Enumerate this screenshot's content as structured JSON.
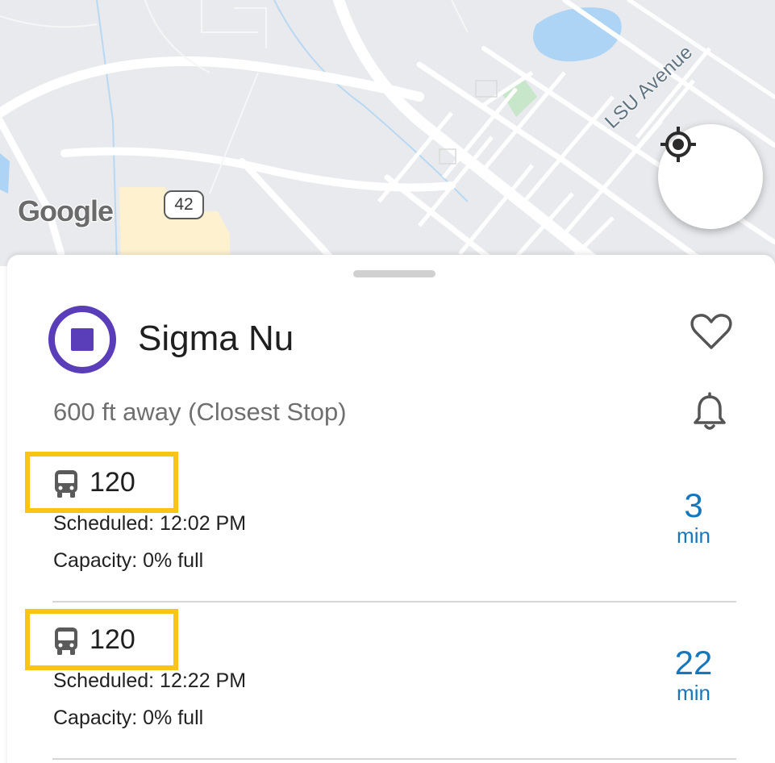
{
  "map": {
    "road_label": "LSU Avenue",
    "route_shield": "42",
    "attribution": "Google",
    "colors": {
      "land": "#e8eaed",
      "road": "#ffffff",
      "water": "#aed4f5",
      "park": "#c8e6c9",
      "sand": "#fdf1cf"
    }
  },
  "stop": {
    "name": "Sigma Nu",
    "distance": "600 ft away (Closest Stop)",
    "icon_color": "#5a3db8",
    "favorite_icon": "heart-outline-icon",
    "notify_icon": "bell-icon"
  },
  "arrivals": [
    {
      "route": "120",
      "scheduled": "Scheduled: 12:02 PM",
      "capacity": "Capacity: 0% full",
      "eta_value": "3",
      "eta_unit": "min"
    },
    {
      "route": "120",
      "scheduled": "Scheduled: 12:22 PM",
      "capacity": "Capacity: 0% full",
      "eta_value": "22",
      "eta_unit": "min"
    }
  ],
  "colors": {
    "accent_eta": "#1677bd",
    "highlight": "#f9c414"
  }
}
